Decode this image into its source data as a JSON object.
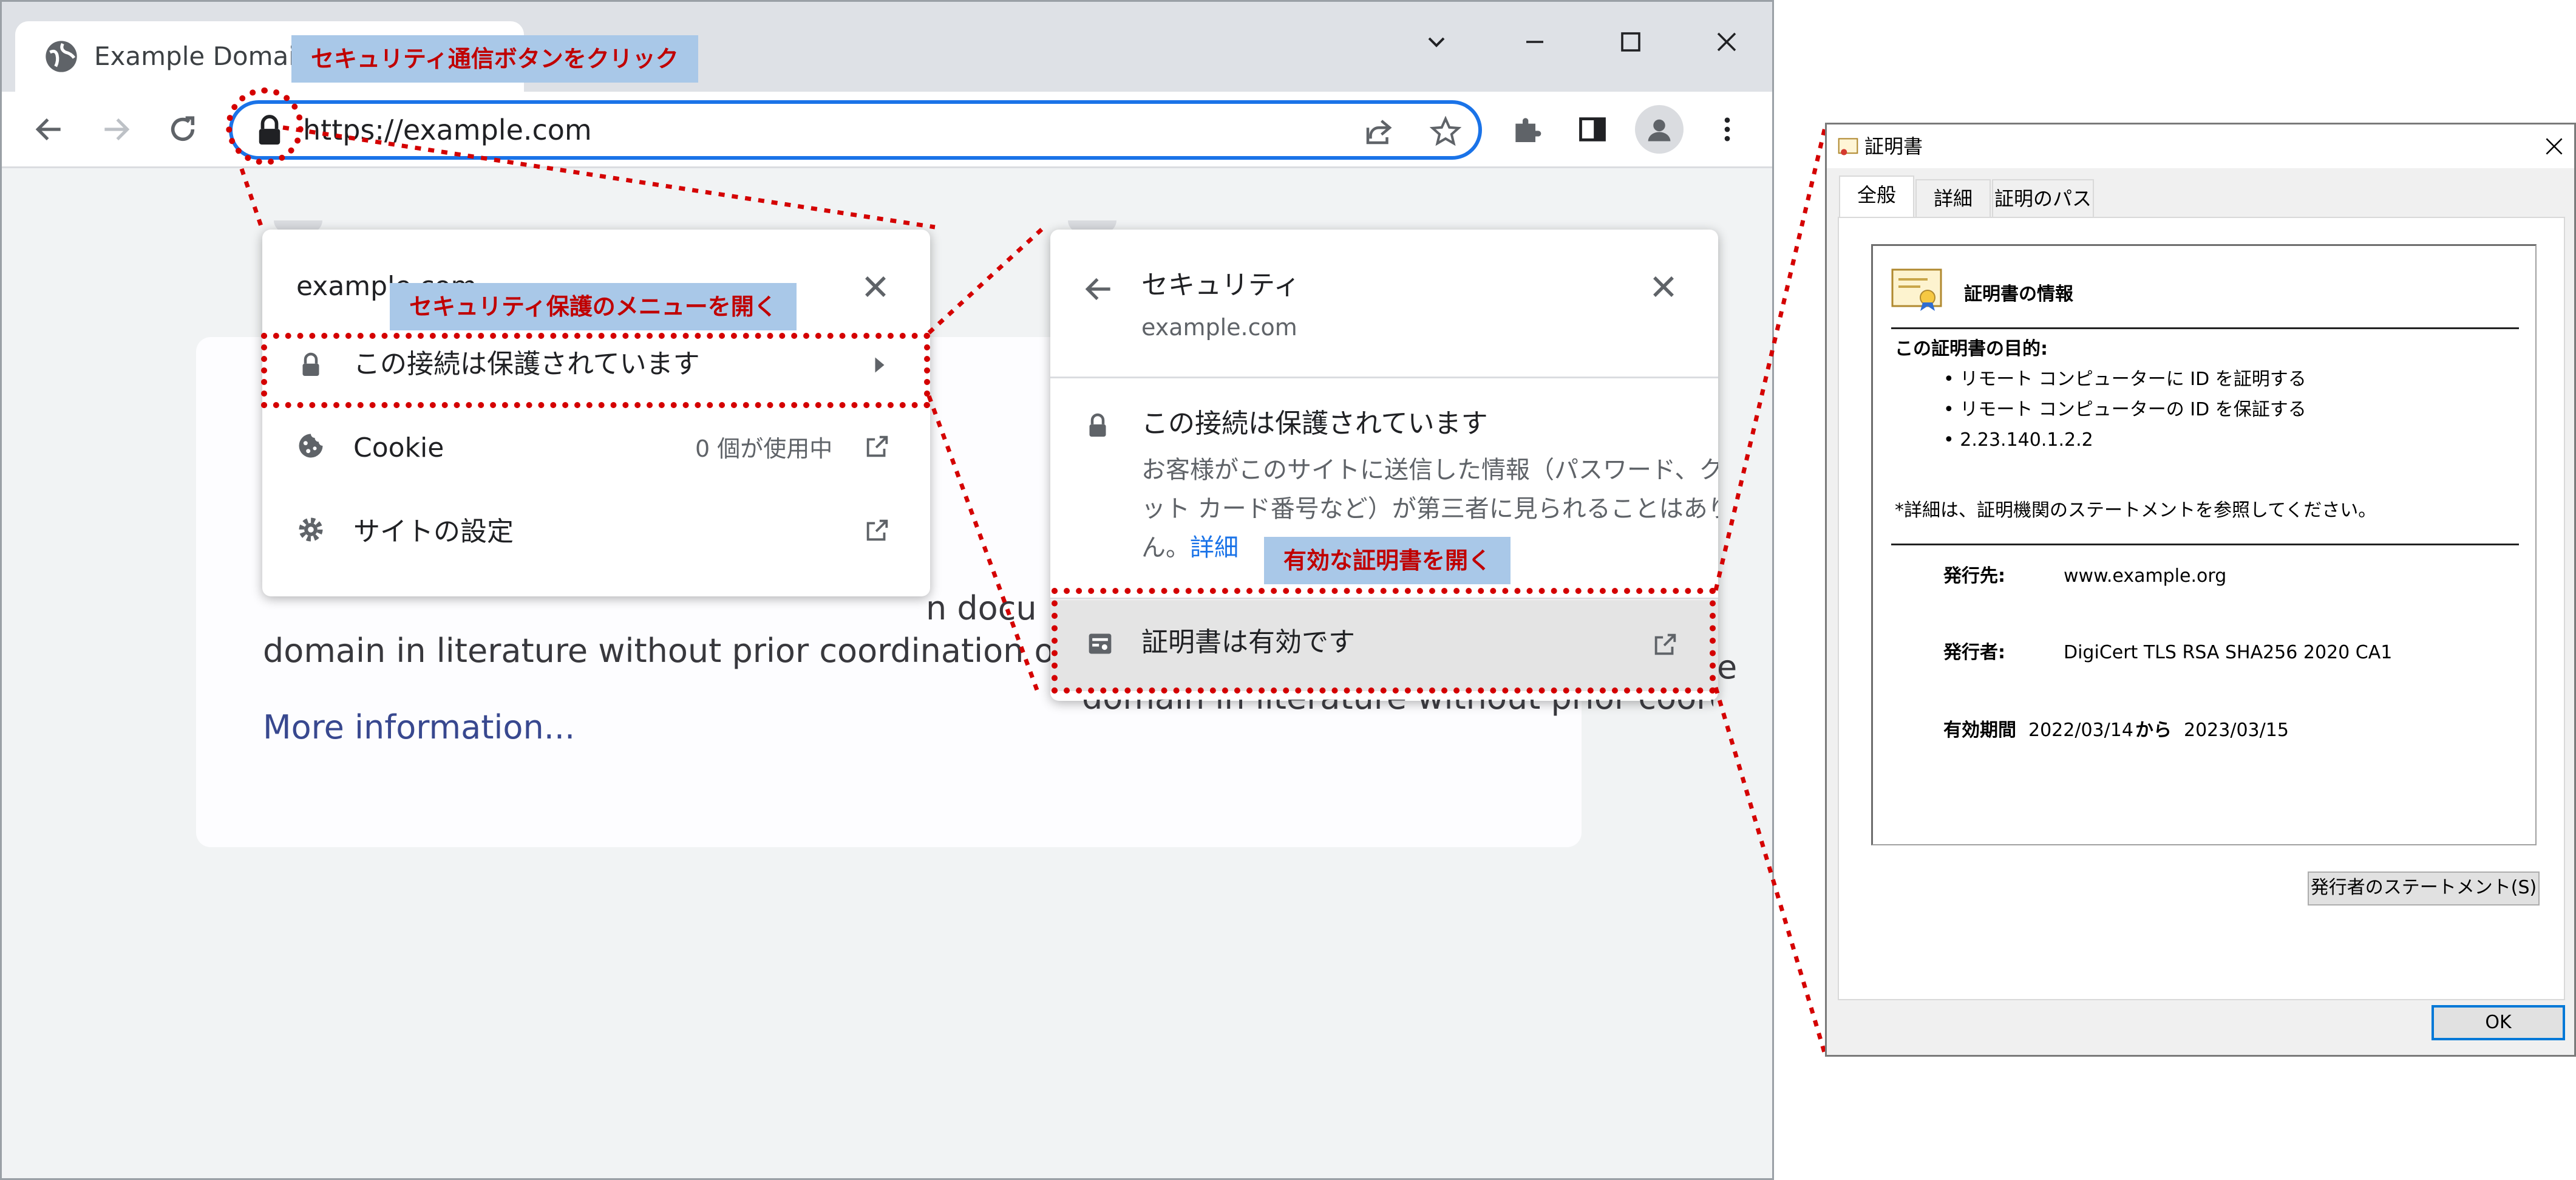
{
  "browser": {
    "tab_title": "Example Domain",
    "url": "https://example.com",
    "page": {
      "line1": "n docu",
      "line2": "domain in literature without prior coordination or ask",
      "link": "More information..."
    }
  },
  "site_popup": {
    "domain": "example.com",
    "connection": "この接続は保護されています",
    "cookie_label": "Cookie",
    "cookie_count": "0 個が使用中",
    "site_settings": "サイトの設定"
  },
  "security_popup": {
    "title": "セキュリティ",
    "domain": "example.com",
    "heading": "この接続は保護されています",
    "desc1": "お客様がこのサイトに送信した情報（パスワード、クレジ",
    "desc2": "ット カード番号など）が第三者に見られることはありませ",
    "desc3": "ん。",
    "details_link": "詳細",
    "cert_valid": "証明書は有効です",
    "bg_text": "domain in literature without prior coordinat",
    "bg_edge": "e"
  },
  "annotations": {
    "step1": "セキュリティ通信ボタンをクリック",
    "step2": "セキュリティ保護のメニューを開く",
    "step3": "有効な証明書を開く"
  },
  "certificate": {
    "window_title": "証明書",
    "tabs": [
      "全般",
      "詳細",
      "証明のパス"
    ],
    "info_title": "証明書の情報",
    "purpose_label": "この証明書の目的:",
    "purposes": [
      "• リモート コンピューターに ID を証明する",
      "• リモート コンピューターの ID を保証する",
      "• 2.23.140.1.2.2"
    ],
    "note": "*詳細は、証明機関のステートメントを参照してください。",
    "issued_to_label": "発行先:",
    "issued_to": "www.example.org",
    "issued_by_label": "発行者:",
    "issued_by": "DigiCert TLS RSA SHA256 2020 CA1",
    "validity_label": "有効期間",
    "valid_from": "2022/03/14",
    "valid_from_to": "から",
    "valid_to": "2023/03/15",
    "statement_button": "発行者のステートメント(S)",
    "ok_button": "OK"
  },
  "colors": {
    "accent": "#1a73e8",
    "annotation_red": "#d40000",
    "callout_bg": "#a9c8e8"
  }
}
